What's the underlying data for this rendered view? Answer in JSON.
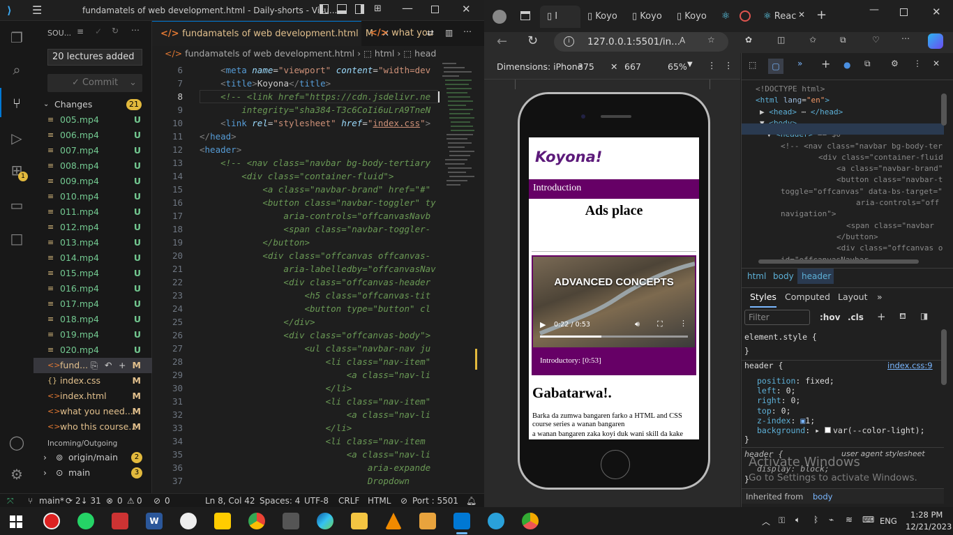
{
  "vscode": {
    "window_title": "fundamatels of web development.html - Daily-shorts - Visu...",
    "sidebar": {
      "header": "SOU...",
      "commit_message": "20 lectures added",
      "commit_label": "Commit",
      "changes_label": "Changes",
      "changes_count": "21",
      "files": [
        {
          "name": "005.mp4",
          "status": "U"
        },
        {
          "name": "006.mp4",
          "status": "U"
        },
        {
          "name": "007.mp4",
          "status": "U"
        },
        {
          "name": "008.mp4",
          "status": "U"
        },
        {
          "name": "009.mp4",
          "status": "U"
        },
        {
          "name": "010.mp4",
          "status": "U"
        },
        {
          "name": "011.mp4",
          "status": "U"
        },
        {
          "name": "012.mp4",
          "status": "U"
        },
        {
          "name": "013.mp4",
          "status": "U"
        },
        {
          "name": "014.mp4",
          "status": "U"
        },
        {
          "name": "015.mp4",
          "status": "U"
        },
        {
          "name": "016.mp4",
          "status": "U"
        },
        {
          "name": "017.mp4",
          "status": "U"
        },
        {
          "name": "018.mp4",
          "status": "U"
        },
        {
          "name": "019.mp4",
          "status": "U"
        },
        {
          "name": "020.mp4",
          "status": "U"
        },
        {
          "name": "fund...",
          "status": "M"
        },
        {
          "name": "index.css",
          "status": "M"
        },
        {
          "name": "index.html",
          "status": "M"
        },
        {
          "name": "what you need....",
          "status": "M"
        },
        {
          "name": "who this course...",
          "status": "M"
        }
      ],
      "incoming_label": "Incoming/Outgoing",
      "branches": [
        {
          "name": "origin/main",
          "count": "2"
        },
        {
          "name": "main",
          "count": "3"
        }
      ]
    },
    "tabs": [
      {
        "label": "fundamatels of web development.html",
        "badge": "M"
      },
      {
        "label": "what you"
      }
    ],
    "breadcrumbs": [
      "fundamatels of web development.html",
      "html",
      "head"
    ],
    "lines": [
      {
        "n": "6",
        "html": "    <span class='pl'>&lt;</span><span class='tg'>meta</span> <span class='at'>name</span>=<span class='sv'>\"viewport\"</span> <span class='at'>content</span>=<span class='sv'>\"width=dev</span>"
      },
      {
        "n": "7",
        "html": "    <span class='pl'>&lt;</span><span class='tg'>title</span><span class='pl'>&gt;</span>Koyona<span class='pl'>&lt;/</span><span class='tg'>title</span><span class='pl'>&gt;</span>"
      },
      {
        "n": "8",
        "html": "    <span class='cm'>&lt;!-- &lt;link href=\"https://cdn.jsdelivr.ne</span>"
      },
      {
        "n": "9",
        "html": "        <span class='cm'>integrity=\"sha384-T3c6CoIi6uLrA9TneN</span>"
      },
      {
        "n": "10",
        "html": "    <span class='pl'>&lt;</span><span class='tg'>link</span> <span class='at'>rel</span>=<span class='sv'>\"stylesheet\"</span> <span class='at'>href</span>=<span class='sv'>\"<u>index.css</u>\"</span><span class='pl'>&gt;</span>"
      },
      {
        "n": "11",
        "html": "<span class='pl'>&lt;/</span><span class='tg'>head</span><span class='pl'>&gt;</span>"
      },
      {
        "n": "12",
        "html": "<span class='pl'>&lt;</span><span class='tg'>header</span><span class='pl'>&gt;</span>"
      },
      {
        "n": "13",
        "html": "    <span class='cm'>&lt;!-- &lt;nav class=\"navbar bg-body-tertiary</span>"
      },
      {
        "n": "14",
        "html": "        <span class='cm'>&lt;div class=\"container-fluid\"&gt;</span>"
      },
      {
        "n": "15",
        "html": "            <span class='cm'>&lt;a class=\"navbar-brand\" href=\"#\"</span>"
      },
      {
        "n": "16",
        "html": "            <span class='cm'>&lt;button class=\"navbar-toggler\" ty</span>"
      },
      {
        "n": "17",
        "html": "                <span class='cm'>aria-controls=\"offcanvasNavb</span>"
      },
      {
        "n": "18",
        "html": "                <span class='cm'>&lt;span class=\"navbar-toggler-</span>"
      },
      {
        "n": "19",
        "html": "            <span class='cm'>&lt;/button&gt;</span>"
      },
      {
        "n": "20",
        "html": "            <span class='cm'>&lt;div class=\"offcanvas offcanvas-</span>"
      },
      {
        "n": "21",
        "html": "                <span class='cm'>aria-labelledby=\"offcanvasNav</span>"
      },
      {
        "n": "22",
        "html": "                <span class='cm'>&lt;div class=\"offcanvas-header</span>"
      },
      {
        "n": "23",
        "html": "                    <span class='cm'>&lt;h5 class=\"offcanvas-tit</span>"
      },
      {
        "n": "24",
        "html": "                    <span class='cm'>&lt;button type=\"button\" cl</span>"
      },
      {
        "n": "25",
        "html": "                <span class='cm'>&lt;/div&gt;</span>"
      },
      {
        "n": "26",
        "html": "                <span class='cm'>&lt;div class=\"offcanvas-body\"&gt;</span>"
      },
      {
        "n": "27",
        "html": "                    <span class='cm'>&lt;ul class=\"navbar-nav ju</span>"
      },
      {
        "n": "28",
        "html": "                        <span class='cm'>&lt;li class=\"nav-item\"</span>"
      },
      {
        "n": "29",
        "html": "                            <span class='cm'>&lt;a class=\"nav-li</span>"
      },
      {
        "n": "30",
        "html": "                        <span class='cm'>&lt;/li&gt;</span>"
      },
      {
        "n": "31",
        "html": "                        <span class='cm'>&lt;li class=\"nav-item\"</span>"
      },
      {
        "n": "32",
        "html": "                            <span class='cm'>&lt;a class=\"nav-li</span>"
      },
      {
        "n": "33",
        "html": "                        <span class='cm'>&lt;/li&gt;</span>"
      },
      {
        "n": "34",
        "html": "                        <span class='cm'>&lt;li class=\"nav-item </span>"
      },
      {
        "n": "35",
        "html": "                            <span class='cm'>&lt;a class=\"nav-li</span>"
      },
      {
        "n": "36",
        "html": "                                <span class='cm'>aria-expande</span>"
      },
      {
        "n": "37",
        "html": "                                <span class='cm'>Dropdown</span>"
      }
    ],
    "status": {
      "branch": "main*",
      "sync": "2↓ 31",
      "problems": "0",
      "warnings": "0",
      "ports": "0",
      "position": "Ln 8, Col 42",
      "spaces": "Spaces: 4",
      "encoding": "UTF-8",
      "eol": "CRLF",
      "language": "HTML",
      "port": "Port : 5501"
    }
  },
  "browser": {
    "tabs": [
      "I",
      "Koyo",
      "Koyo",
      "Koyo",
      "Reac"
    ],
    "url": "127.0.0.1:5501/in...",
    "device": {
      "label": "Dimensions: iPhone",
      "width": "375",
      "height": "667",
      "zoom": "65%"
    },
    "page": {
      "brand": "Koyona!",
      "nav_item": "Introduction",
      "ads_title": "Ads place",
      "video_overlay": "ADVANCED CONCEPTS",
      "video_time": "0:22 / 0:53",
      "video_progress": 0.415,
      "video_caption": "Introductory: [0:53]",
      "section_title": "Gabatarwa!.",
      "para1": "Barka da zumwa bangaren farko a HTML and CSS course series a wanan bangaren",
      "para2": "a wanan bangaren zaka koyi duk wani skill da kake"
    }
  },
  "devtools": {
    "dom_lines": [
      {
        "html": "<span class='dc'>&lt;!DOCTYPE html&gt;</span>",
        "indent": 20
      },
      {
        "html": "<span class='dt'>&lt;html</span> <span class='da'>lang</span>=<span class='dv'>\"en\"</span><span class='dt'>&gt;</span>",
        "indent": 20
      },
      {
        "html": "▶ <span class='dt'>&lt;head&gt;</span> ⋯ <span class='dt'>&lt;/head&gt;</span>",
        "indent": 26
      },
      {
        "html": "▼ <span class='dt'>&lt;body&gt;</span>",
        "indent": 26
      },
      {
        "html": "▼ <span class='dt'>&lt;header&gt;</span> <span class='dc'>== $0</span>",
        "indent": 36
      },
      {
        "html": "<span class='dc'>&lt;!-- &lt;nav class=\"navbar bg-body-ter</span>",
        "indent": 56
      },
      {
        "html": "<span class='dc'>&lt;div class=\"container-fluid</span>",
        "indent": 110
      },
      {
        "html": "<span class='dc'>&lt;a class=\"navbar-brand\"</span>",
        "indent": 136
      },
      {
        "html": "<span class='dc'>&lt;button class=\"navbar-t</span>",
        "indent": 136
      },
      {
        "html": "<span class='dc'>toggle=\"offcanvas\" data-bs-target=\"</span>",
        "indent": 56
      },
      {
        "html": "<span class='dc'>aria-controls=\"off</span>",
        "indent": 164
      },
      {
        "html": "<span class='dc'>navigation\"&gt;</span>",
        "indent": 56
      },
      {
        "html": "<span class='dc'>&lt;span class=\"navbar</span>",
        "indent": 150
      },
      {
        "html": "<span class='dc'>&lt;/button&gt;</span>",
        "indent": 136
      },
      {
        "html": "<span class='dc'>&lt;div class=\"offcanvas o</span>",
        "indent": 136
      },
      {
        "html": "<span class='dc'>id=\"offcanvasNavbar</span>",
        "indent": 56
      }
    ],
    "breadcrumb": [
      "html",
      "body",
      "header"
    ],
    "panel_tabs": [
      "Styles",
      "Computed",
      "Layout"
    ],
    "filter_placeholder": "Filter",
    "hov": ":hov",
    "cls": ".cls",
    "element_style": "element.style {",
    "close_brace": "}",
    "header_selector": "header {",
    "header_source": "index.css:9",
    "props": [
      {
        "p": "position",
        "v": "fixed;"
      },
      {
        "p": "left",
        "v": "0;"
      },
      {
        "p": "right",
        "v": "0;"
      },
      {
        "p": "top",
        "v": "0;"
      },
      {
        "p": "z-index",
        "v": "1;"
      },
      {
        "p": "background",
        "v": "var(--color-light);"
      }
    ],
    "ua_selector": "header {",
    "ua_source": "user agent stylesheet",
    "ua_prop": "display: block;",
    "inherited": "Inherited from",
    "inherited_el": "body",
    "watermark1": "Activate Windows",
    "watermark2": "Go to Settings to activate Windows."
  },
  "taskbar": {
    "time": "1:28 PM",
    "date": "12/21/2023",
    "lang": "ENG"
  },
  "colors": {
    "accent": "#0078d4",
    "purple": "#660066",
    "brand_text": "#5c1a7a"
  }
}
